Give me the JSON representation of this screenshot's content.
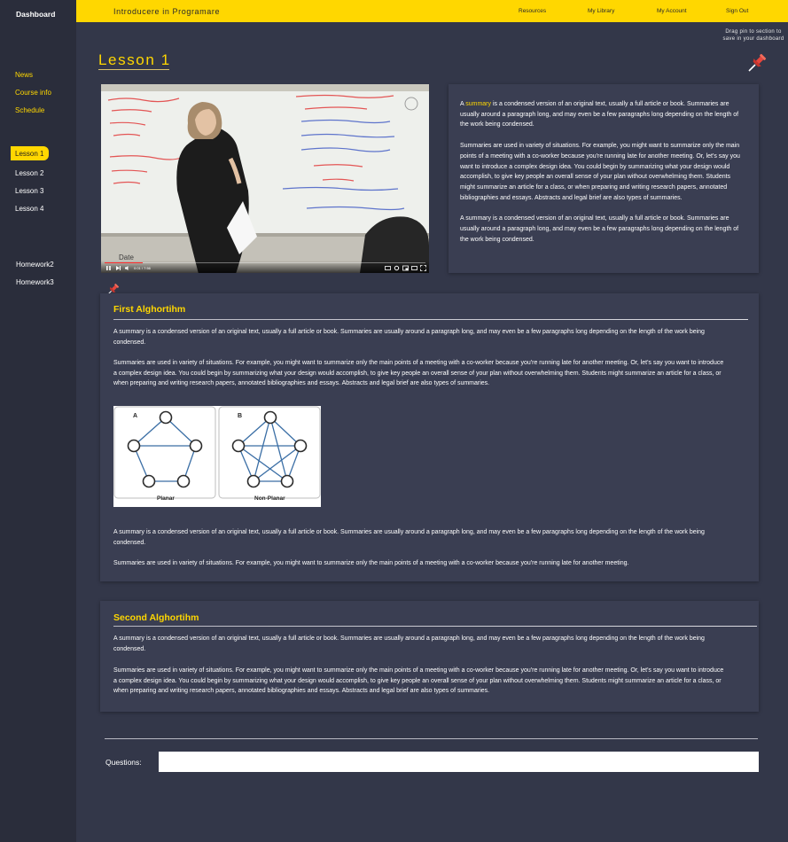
{
  "sidebar": {
    "title": "Dashboard",
    "links": [
      "News",
      "Course info",
      "Schedule"
    ],
    "lessons": [
      "Lesson 1",
      "Lesson 2",
      "Lesson 3",
      "Lesson 4"
    ],
    "homework": [
      "Homework2",
      "Homework3"
    ]
  },
  "header": {
    "title": "Introducere in Programare",
    "nav": [
      "Resources",
      "My Library",
      "My Account",
      "Sign Out"
    ]
  },
  "pin_hint": "Drag pin to section to save in your dashboard",
  "lesson_title": "Lesson 1",
  "video": {
    "time": "0:01 / 7:56",
    "progress": 0.12
  },
  "summary_card": {
    "p1_pre": "A ",
    "p1_link": "summary",
    "p1_post": " is a condensed version of an original text, usually a full article or book. Summaries are usually around a paragraph long, and may even be a few paragraphs long depending on the length of the work being condensed.",
    "p2": "Summaries are used in variety of situations. For example, you might want to summarize only the main points of a meeting with a co-worker because you're running late for another meeting. Or, let's say you want to introduce a complex design idea. You could begin by summarizing what your design would accomplish, to give key people an overall sense of your plan without overwhelming them. Students might summarize an article for a class, or when preparing and writing research papers, annotated bibliographies and essays. Abstracts and legal brief are also types of summaries.",
    "p3": "A summary is a condensed version of an original text, usually a full article or book. Summaries are usually around a paragraph long, and may even be a few paragraphs long depending on the length of the work being condensed."
  },
  "first_section": {
    "title": "First Alghortihm",
    "p1": "A summary is a condensed version of an original text, usually a full article or book. Summaries are usually around a paragraph long, and may even be a few paragraphs long depending on the length of the work being condensed.",
    "p2": "Summaries are used in variety of situations. For example, you might want to summarize only the main points of a meeting with a co-worker because you're running late for another meeting. Or, let's say you want to introduce a complex design idea. You could begin by summarizing what your design would accomplish, to give key people an overall sense of your plan without overwhelming them. Students might summarize an article for a class, or when preparing and writing research papers, annotated bibliographies and essays. Abstracts and legal brief are also types of summaries.",
    "diagram": {
      "label_a": "A",
      "label_b": "B",
      "caption_a": "Planar",
      "caption_b": "Non-Planar"
    },
    "p3": "A summary is a condensed version of an original text, usually a full article or book. Summaries are usually around a paragraph long, and may even be a few paragraphs long depending on the length of the work being condensed.",
    "p4": "Summaries are used in variety of situations. For example, you might want to summarize only the main points of a meeting with a co-worker because you're running late for another meeting."
  },
  "second_section": {
    "title": "Second Alghortihm",
    "p1": "A summary is a condensed version of an original text, usually a full article or book. Summaries are usually around a paragraph long, and may even be a few paragraphs long depending on the length of the work being condensed.",
    "p2": "Summaries are used in variety of situations. For example, you might want to summarize only the main points of a meeting with a co-worker because you're running late for another meeting. Or, let's say you want to introduce a complex design idea. You could begin by summarizing what your design would accomplish, to give key people an overall sense of your plan without overwhelming them. Students might summarize an article for a class, or when preparing and writing research papers, annotated bibliographies and essays. Abstracts and legal brief are also types of summaries."
  },
  "questions": {
    "label": "Questions:",
    "value": ""
  },
  "colors": {
    "accent": "#ffd700",
    "background": "#333749",
    "sidebar": "#2a2d3b",
    "card": "#3a3e52",
    "pin": "#e8453c"
  },
  "icons": [
    "pushpin-icon",
    "play-pause-icon",
    "next-icon",
    "volume-icon",
    "captions-icon",
    "settings-icon",
    "miniplayer-icon",
    "theater-icon",
    "fullscreen-icon"
  ]
}
